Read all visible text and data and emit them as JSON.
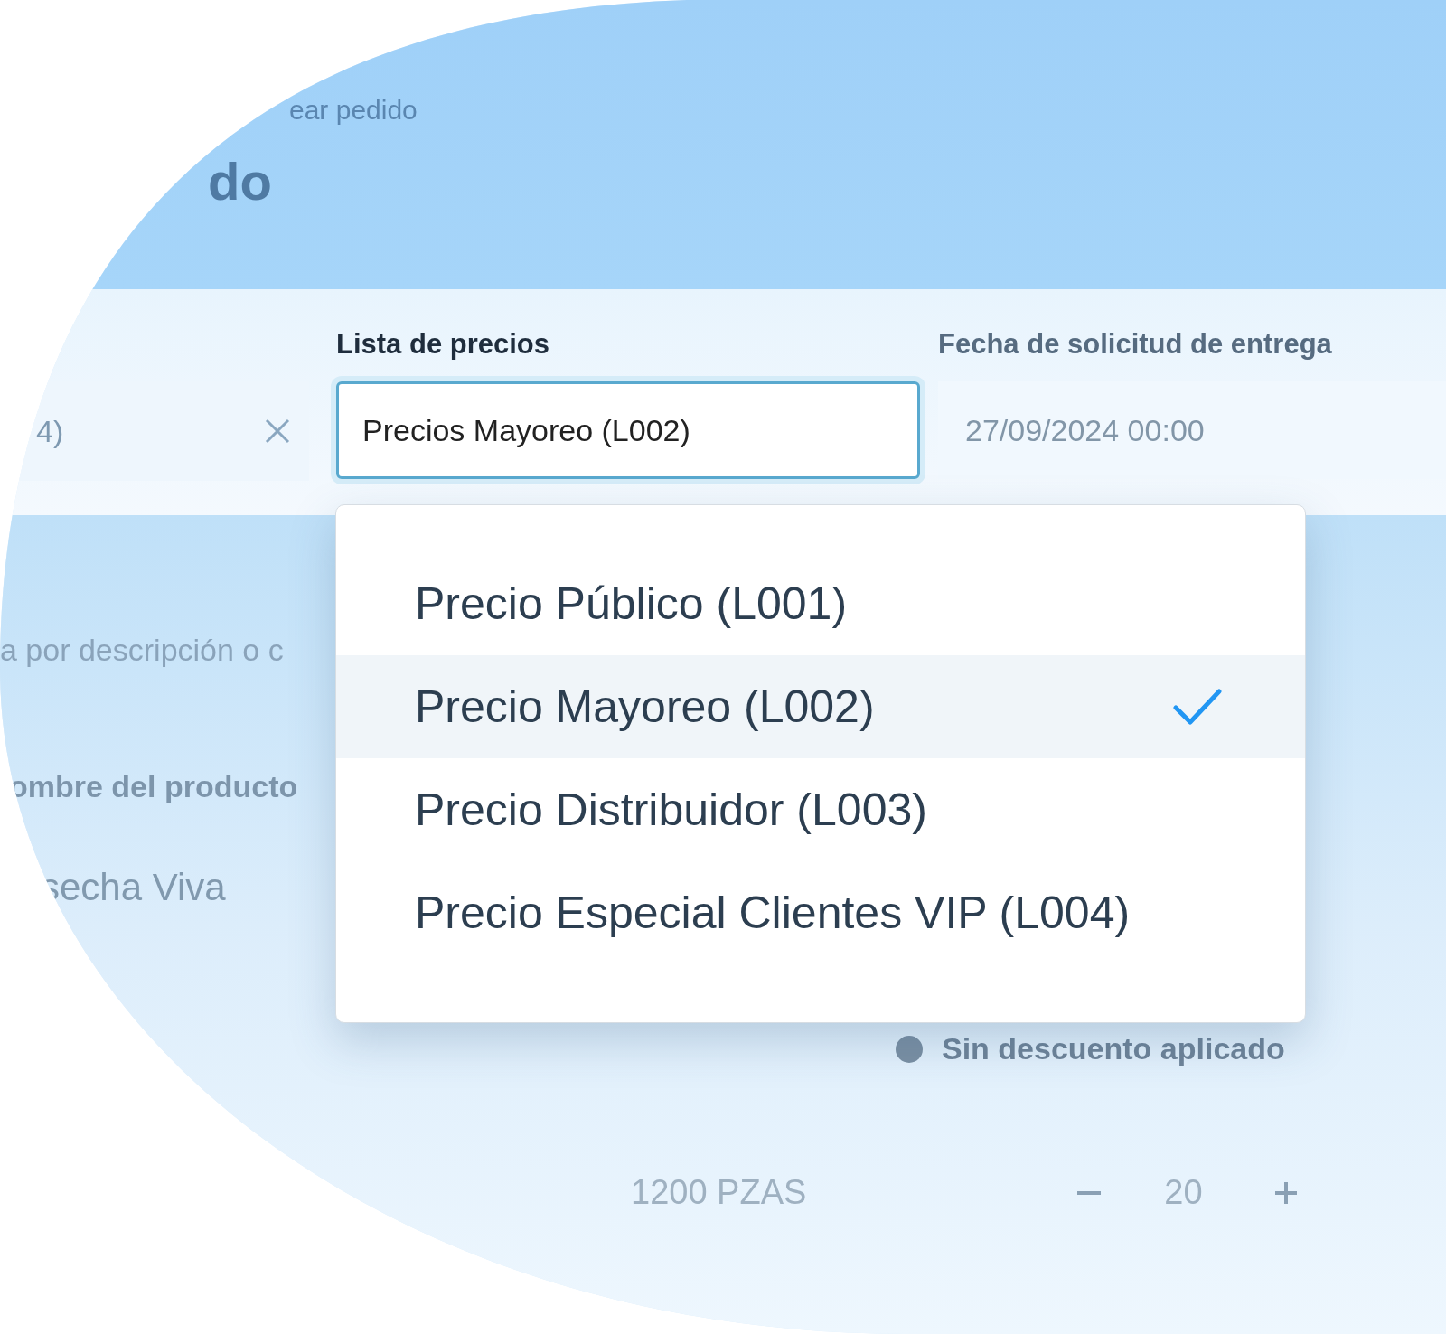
{
  "header": {
    "breadcrumb": "ear pedido",
    "title": "do"
  },
  "form": {
    "customer_field": {
      "value": "4)"
    },
    "price_list": {
      "label": "Lista de precios",
      "value": "Precios Mayoreo (L002)",
      "expanded": true
    },
    "delivery_date": {
      "label": "Fecha de solicitud de entrega",
      "value": "27/09/2024 00:00"
    }
  },
  "price_list_options": [
    {
      "label": "Precio Público (L001)",
      "selected": false
    },
    {
      "label": "Precio Mayoreo (L002)",
      "selected": true
    },
    {
      "label": "Precio Distribuidor (L003)",
      "selected": false
    },
    {
      "label": "Precio Especial Clientes VIP (L004)",
      "selected": false
    }
  ],
  "search": {
    "placeholder": "a por descripción o c"
  },
  "products": {
    "column_1": "ombre del producto",
    "rows": [
      {
        "name": "secha Viva",
        "stock": "1200 PZAS",
        "quantity": "20"
      }
    ]
  },
  "discount_status": "Sin descuento aplicado"
}
